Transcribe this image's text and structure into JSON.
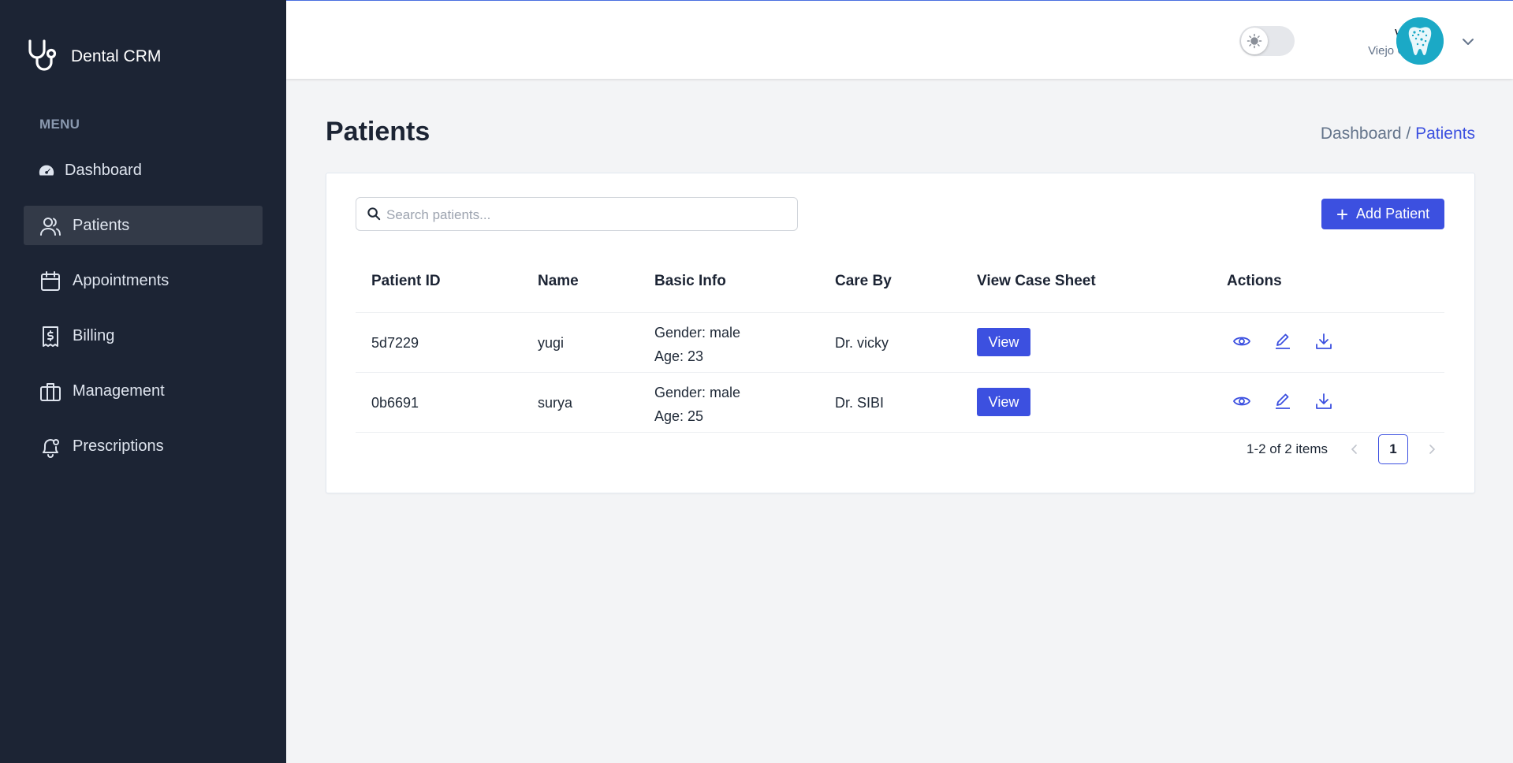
{
  "app": {
    "name": "Dental CRM"
  },
  "sidebar": {
    "menu_label": "MENU",
    "items": [
      {
        "label": "Dashboard",
        "icon": "dashboard-icon"
      },
      {
        "label": "Patients",
        "icon": "users-icon",
        "active": true
      },
      {
        "label": "Appointments",
        "icon": "calendar-icon"
      },
      {
        "label": "Billing",
        "icon": "receipt-icon"
      },
      {
        "label": "Management",
        "icon": "briefcase-icon"
      },
      {
        "label": "Prescriptions",
        "icon": "bell-icon"
      }
    ]
  },
  "header": {
    "user_name": "vicky",
    "clinic": "Viejo Clinic",
    "theme_toggle": "light"
  },
  "page": {
    "title": "Patients",
    "breadcrumb": {
      "parent": "Dashboard /",
      "current": "Patients"
    }
  },
  "toolbar": {
    "search_placeholder": "Search patients...",
    "search_value": "",
    "add_label": "Add Patient"
  },
  "table": {
    "columns": [
      "Patient ID",
      "Name",
      "Basic Info",
      "Care By",
      "View Case Sheet",
      "Actions"
    ],
    "rows": [
      {
        "id": "5d7229",
        "name": "yugi",
        "gender": "Gender: male",
        "age": "Age: 23",
        "care_by": "Dr. vicky",
        "view_label": "View"
      },
      {
        "id": "0b6691",
        "name": "surya",
        "gender": "Gender: male",
        "age": "Age: 25",
        "care_by": "Dr. SIBI",
        "view_label": "View"
      }
    ]
  },
  "pagination": {
    "range": "1-2 of 2 items",
    "current_page": "1",
    "prev": "<",
    "next": ">"
  },
  "colors": {
    "sidebar_bg": "#1c2434",
    "accent": "#3c50e0",
    "active_item_bg": "#333a48"
  }
}
